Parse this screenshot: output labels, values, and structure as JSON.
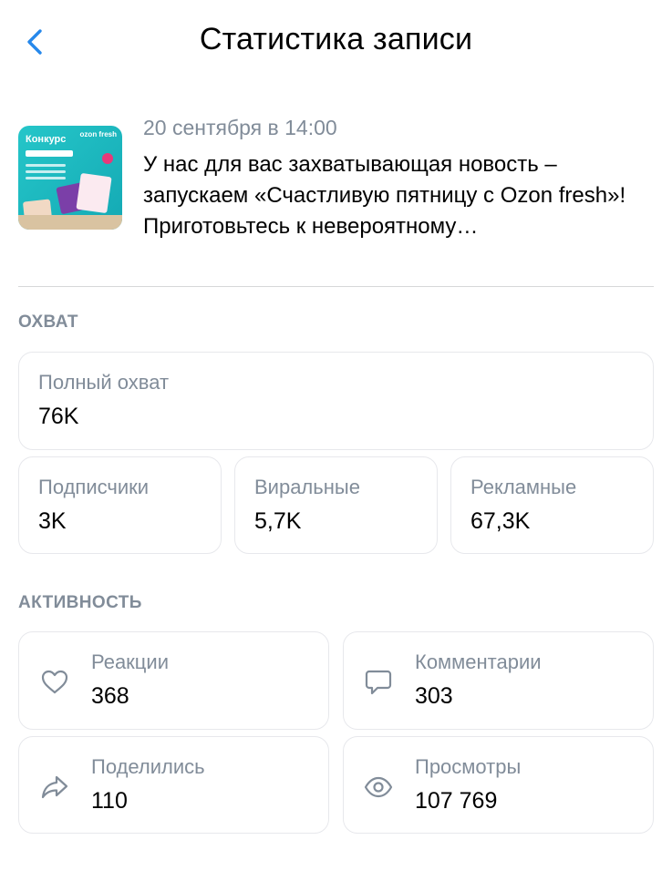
{
  "header": {
    "title": "Статистика записи"
  },
  "post": {
    "date": "20 сентября в 14:00",
    "text": "У нас для вас захватывающая новость – запускаем «Счастливую пятницу с Ozon fresh»! Приготовьтесь к невероятному…",
    "thumbnail": {
      "title": "Конкурс",
      "brand": "ozon fresh"
    }
  },
  "reach": {
    "section_title": "ОХВАТ",
    "total": {
      "label": "Полный охват",
      "value": "76K"
    },
    "subscribers": {
      "label": "Подписчики",
      "value": "3K"
    },
    "viral": {
      "label": "Виральные",
      "value": "5,7K"
    },
    "ads": {
      "label": "Рекламные",
      "value": "67,3K"
    }
  },
  "activity": {
    "section_title": "АКТИВНОСТЬ",
    "reactions": {
      "label": "Реакции",
      "value": "368",
      "icon": "heart-icon"
    },
    "comments": {
      "label": "Комментарии",
      "value": "303",
      "icon": "comment-icon"
    },
    "shares": {
      "label": "Поделились",
      "value": "110",
      "icon": "share-icon"
    },
    "views": {
      "label": "Просмотры",
      "value": "107 769",
      "icon": "eye-icon"
    }
  },
  "colors": {
    "accent": "#2688eb",
    "secondary_text": "#818c99",
    "card_border": "#e7e8ec"
  }
}
